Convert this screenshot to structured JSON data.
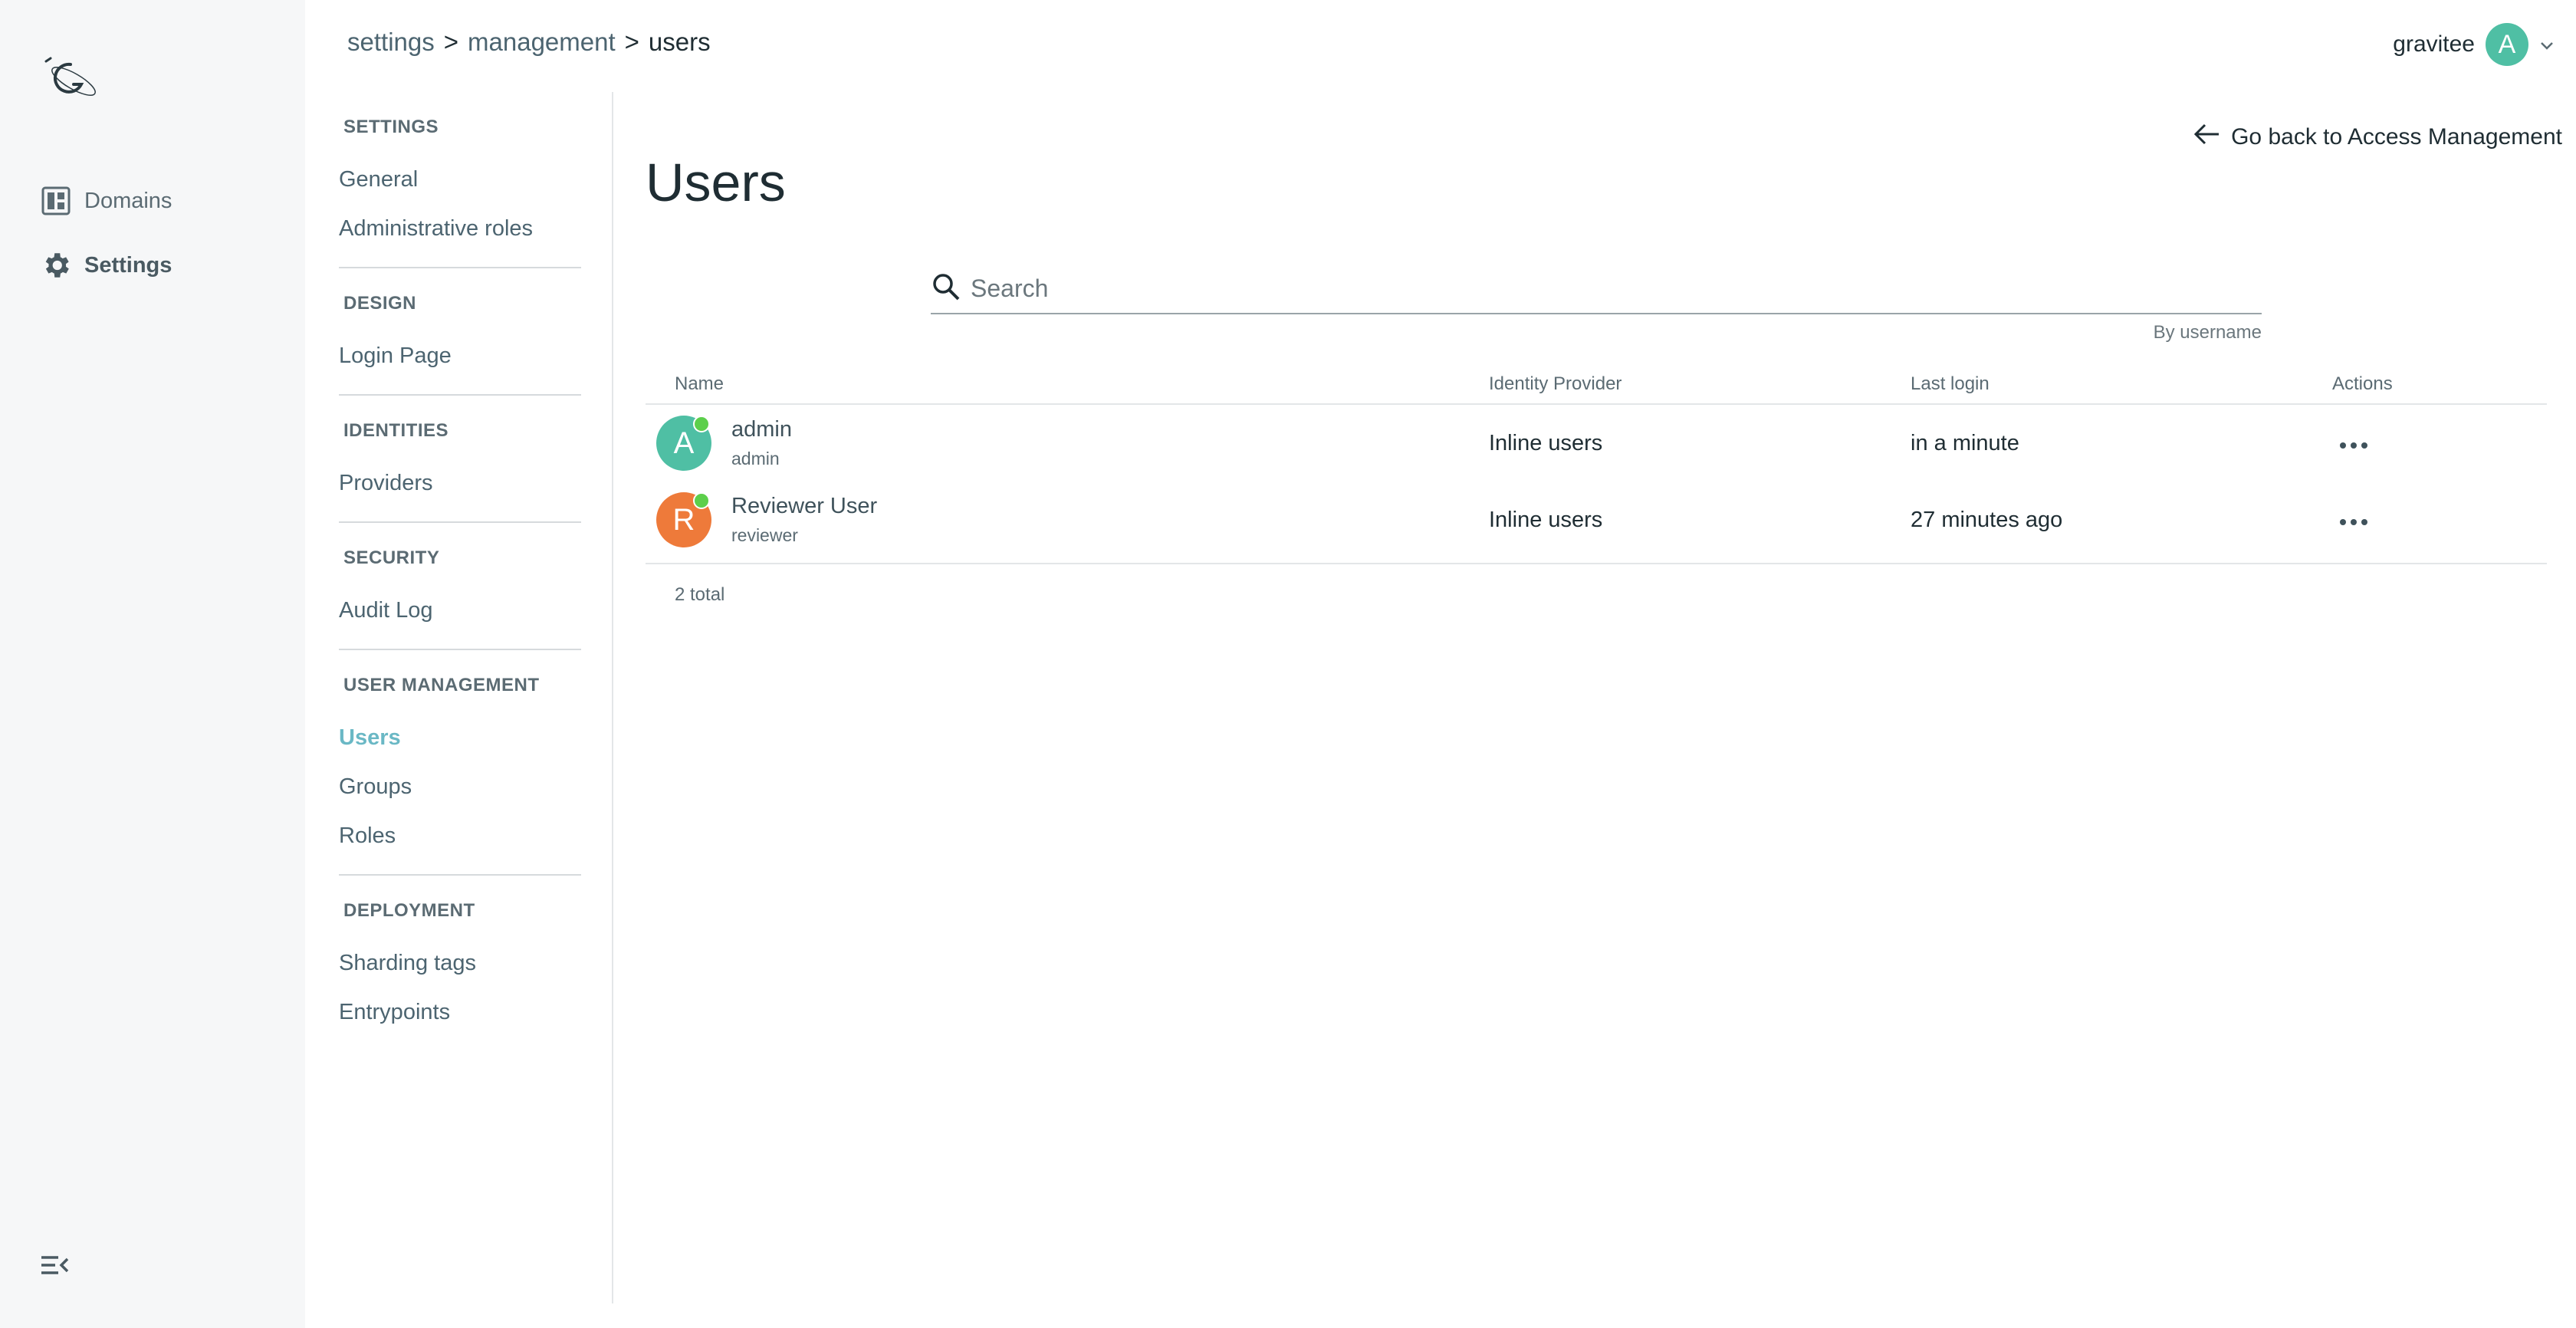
{
  "breadcrumb": {
    "items": [
      "settings",
      "management",
      "users"
    ],
    "separator": ">"
  },
  "user_menu": {
    "name": "gravitee",
    "initial": "A"
  },
  "app_nav": {
    "items": [
      {
        "label": "Domains",
        "icon": "dashboard-icon"
      },
      {
        "label": "Settings",
        "icon": "gear-icon"
      }
    ]
  },
  "settings_nav": {
    "sections": [
      {
        "title": "SETTINGS",
        "links": [
          "General",
          "Administrative roles"
        ]
      },
      {
        "title": "DESIGN",
        "links": [
          "Login Page"
        ]
      },
      {
        "title": "IDENTITIES",
        "links": [
          "Providers"
        ]
      },
      {
        "title": "SECURITY",
        "links": [
          "Audit Log"
        ]
      },
      {
        "title": "USER MANAGEMENT",
        "links": [
          "Users",
          "Groups",
          "Roles"
        ]
      },
      {
        "title": "DEPLOYMENT",
        "links": [
          "Sharding tags",
          "Entrypoints"
        ]
      }
    ],
    "active": "Users"
  },
  "page": {
    "title": "Users",
    "back_label": "Go back to Access Management"
  },
  "search": {
    "placeholder": "Search",
    "value": "",
    "hint": "By username"
  },
  "table": {
    "columns": [
      "Name",
      "Identity Provider",
      "Last login",
      "Actions"
    ],
    "rows": [
      {
        "initial": "A",
        "display_name": "admin",
        "username": "admin",
        "identity_provider": "Inline users",
        "last_login": "in a minute",
        "avatar_color": "#4fbfa4",
        "online": true
      },
      {
        "initial": "R",
        "display_name": "Reviewer User",
        "username": "reviewer",
        "identity_provider": "Inline users",
        "last_login": "27 minutes ago",
        "avatar_color": "#ee7a3a",
        "online": true
      }
    ],
    "total": "2 total"
  },
  "colors": {
    "accent": "#6ab8c5",
    "online": "#5ccf4b"
  }
}
